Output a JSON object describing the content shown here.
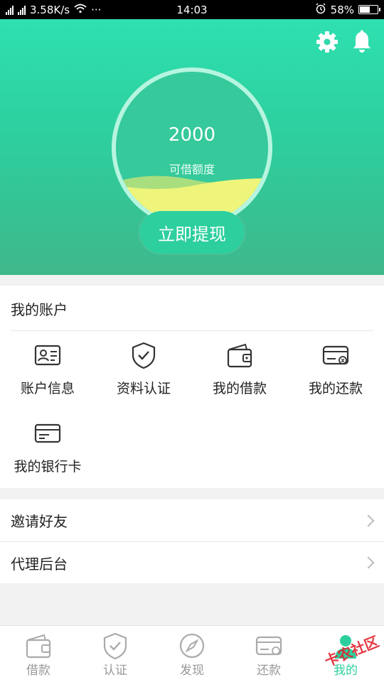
{
  "statusbar": {
    "network_1": "4G",
    "network_2": "2G",
    "speed": "3.58K/s",
    "more": "···",
    "time": "14:03",
    "battery": "58%",
    "battery_level": 0.58
  },
  "header": {
    "amount": "2000",
    "amount_label": "可借额度",
    "withdraw_label": "立即提现",
    "colors": {
      "primary": "#2dcf9e",
      "wave": "#eef57a"
    }
  },
  "account": {
    "title": "我的账户",
    "items": [
      {
        "label": "账户信息",
        "icon": "id-card-icon"
      },
      {
        "label": "资料认证",
        "icon": "shield-check-icon"
      },
      {
        "label": "我的借款",
        "icon": "wallet-icon"
      },
      {
        "label": "我的还款",
        "icon": "card-repay-icon"
      },
      {
        "label": "我的银行卡",
        "icon": "bank-card-icon"
      }
    ]
  },
  "menu": [
    {
      "label": "邀请好友"
    },
    {
      "label": "代理后台"
    }
  ],
  "tabs": [
    {
      "label": "借款",
      "icon": "wallet-icon"
    },
    {
      "label": "认证",
      "icon": "shield-check-icon"
    },
    {
      "label": "发现",
      "icon": "compass-icon"
    },
    {
      "label": "还款",
      "icon": "card-repay-icon"
    },
    {
      "label": "我的",
      "icon": "user-icon",
      "active": true
    }
  ],
  "watermark": "卡农社区"
}
